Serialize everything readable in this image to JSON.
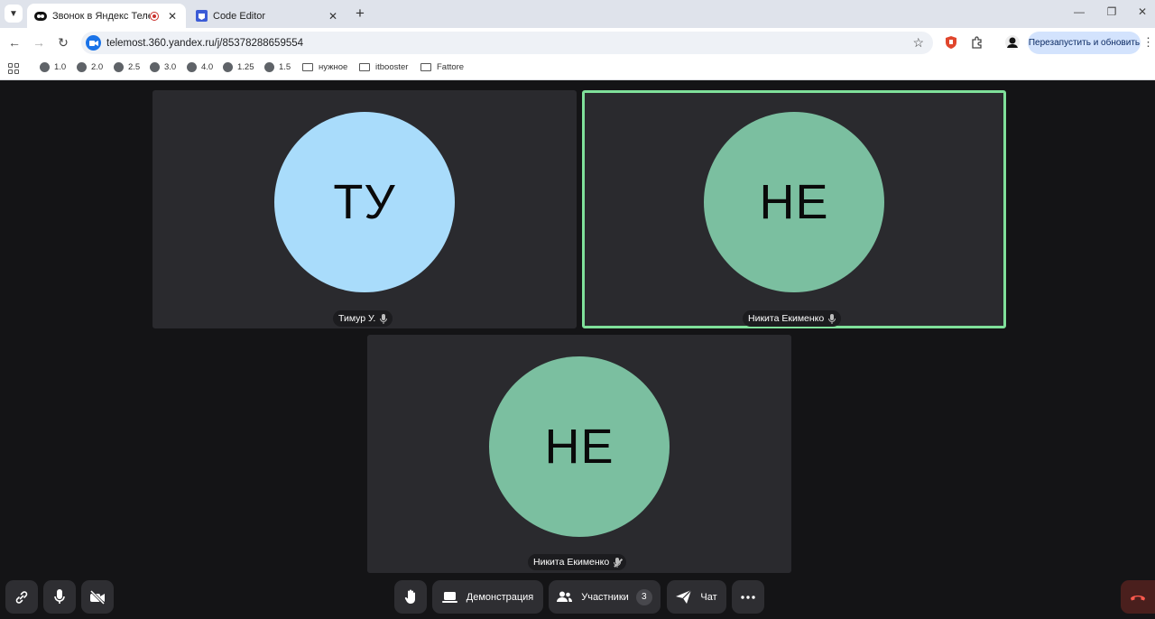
{
  "browser": {
    "tabs": [
      {
        "title": "Звонок в Яндекс Телемост",
        "active": true,
        "icon": "telemost-icon"
      },
      {
        "title": "Code Editor",
        "active": false,
        "icon": "code-editor-icon"
      }
    ],
    "url": "telemost.360.yandex.ru/j/85378288659554",
    "relaunch_label": "Перезапустить и обновить",
    "bookmarks": [
      {
        "label": "1.0",
        "icon": "globe-icon"
      },
      {
        "label": "2.0",
        "icon": "globe-icon"
      },
      {
        "label": "2.5",
        "icon": "globe-icon"
      },
      {
        "label": "3.0",
        "icon": "globe-icon"
      },
      {
        "label": "4.0",
        "icon": "globe-icon"
      },
      {
        "label": "1.25",
        "icon": "globe-icon"
      },
      {
        "label": "1.5",
        "icon": "globe-icon"
      },
      {
        "label": "нужное",
        "icon": "folder-icon"
      },
      {
        "label": "itbooster",
        "icon": "folder-icon"
      },
      {
        "label": "Fattore",
        "icon": "folder-icon"
      }
    ]
  },
  "participants": [
    {
      "initials": "ТУ",
      "name": "Тимур У.",
      "color": "#a9dcfb",
      "speaking": false,
      "mic_muted": false
    },
    {
      "initials": "НЕ",
      "name": "Никита Екименко",
      "color": "#7bbfa0",
      "speaking": true,
      "mic_muted": false
    },
    {
      "initials": "НЕ",
      "name": "Никита Екименко",
      "color": "#7bbfa0",
      "speaking": false,
      "mic_muted": true
    }
  ],
  "controls": {
    "screen_share_label": "Демонстрация",
    "participants_label": "Участники",
    "participants_count": "3",
    "chat_label": "Чат"
  },
  "colors": {
    "speaking_border": "#7fe09a",
    "tile_bg": "#2a2a2e",
    "stage_bg": "#141416",
    "end_call_bg": "#4a1f1d"
  }
}
